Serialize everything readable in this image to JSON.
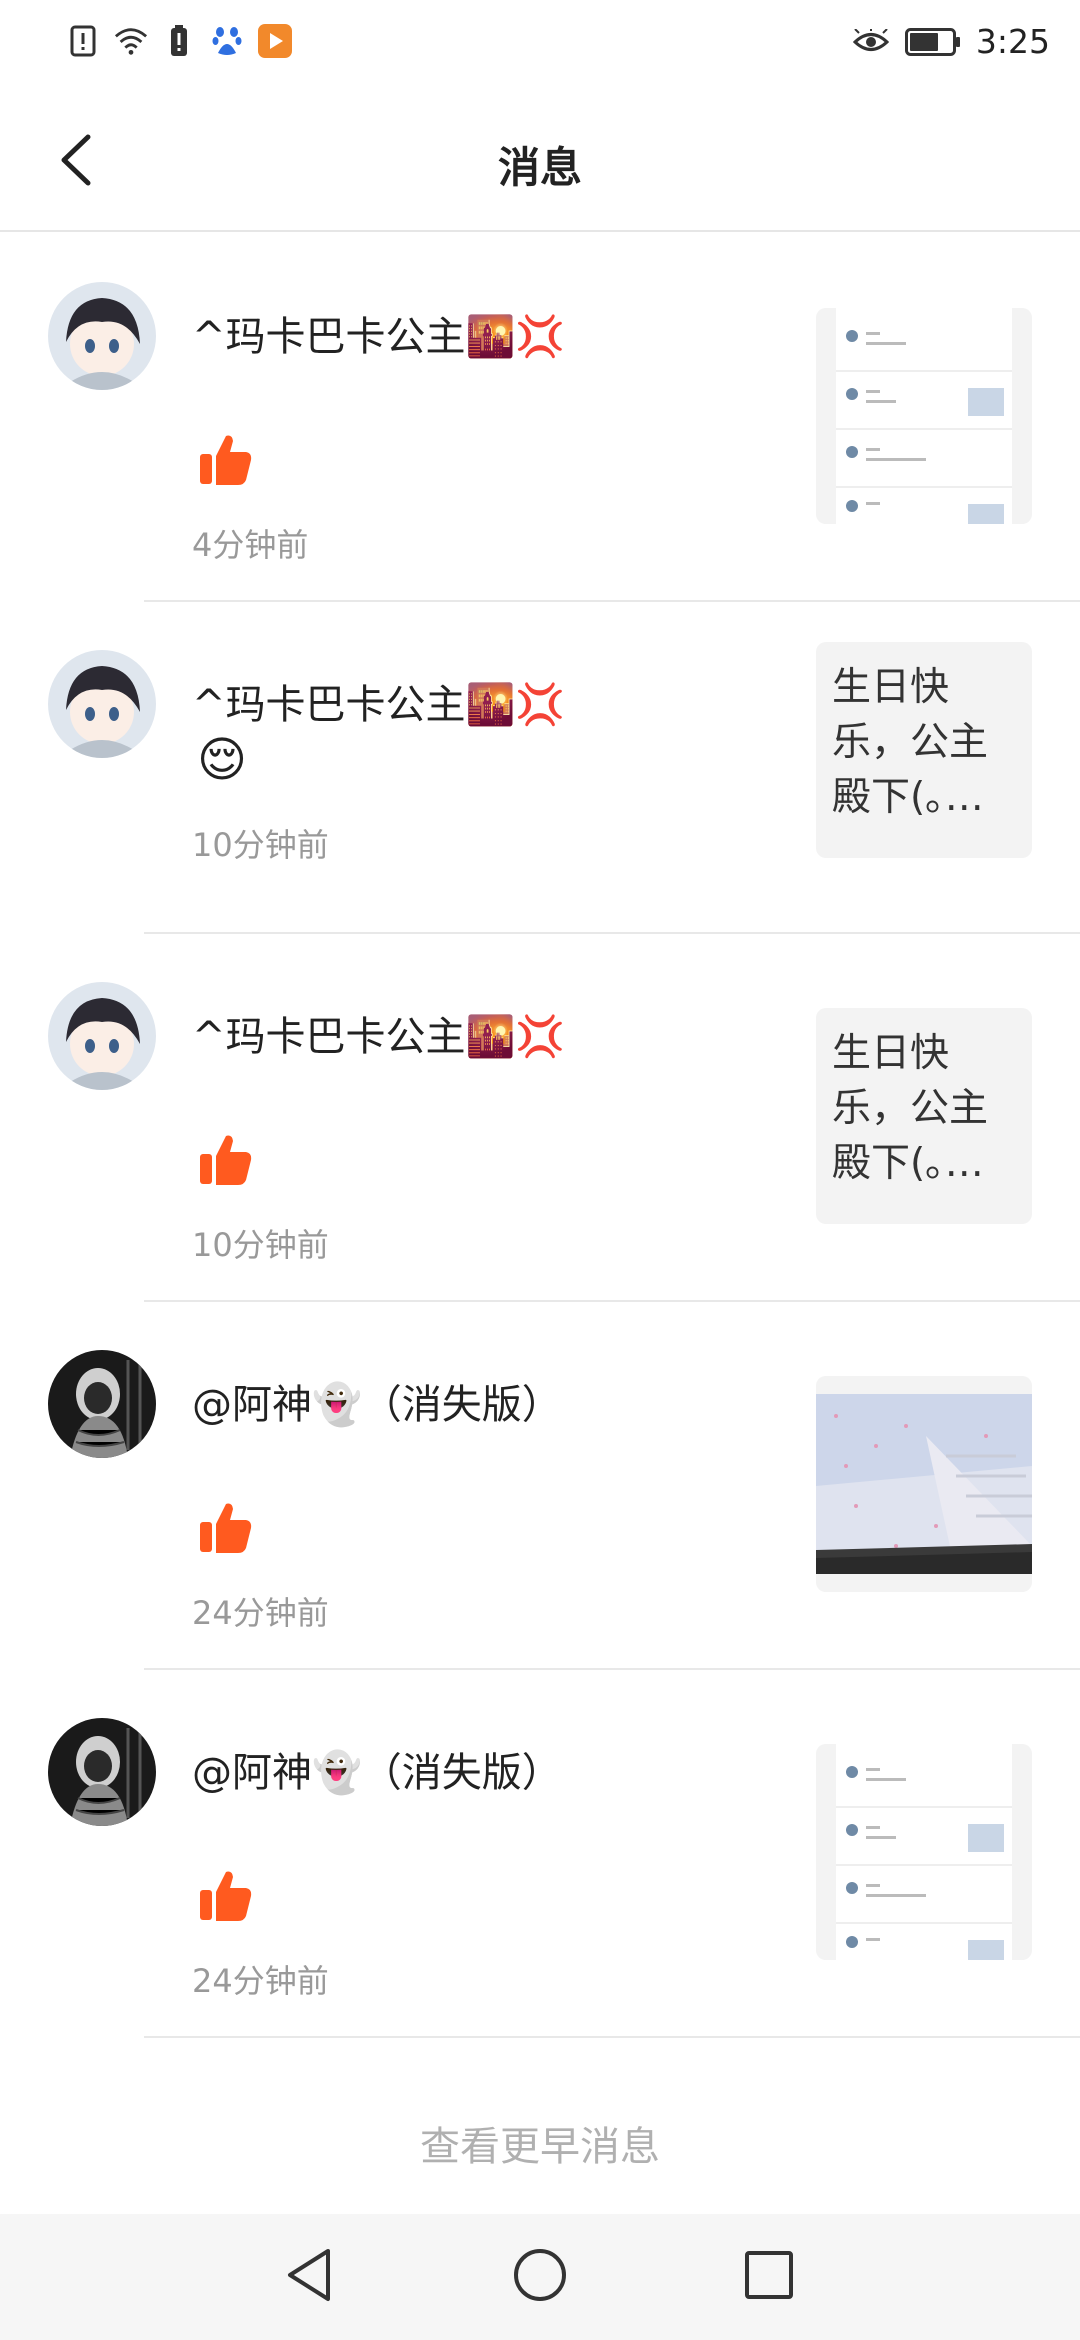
{
  "status_bar": {
    "time": "3:25",
    "left_icons": [
      "alert-icon",
      "wifi-icon",
      "battery-saver-icon",
      "baidu-paw-icon",
      "play-app-icon"
    ],
    "right_icons": [
      "eye-icon",
      "battery-icon"
    ]
  },
  "header": {
    "title": "消息",
    "back_icon": "chevron-left-icon"
  },
  "messages": [
    {
      "user": "^玛卡巴卡公主🌇💢",
      "action_type": "like",
      "content": "",
      "time": "4分钟前",
      "thumb_type": "screenshot",
      "thumb_text": ""
    },
    {
      "user": "^玛卡巴卡公主🌇💢",
      "action_type": "emoji",
      "content": "😌",
      "time": "10分钟前",
      "thumb_type": "text",
      "thumb_text": "生日快乐，公主殿下(｡…"
    },
    {
      "user": "^玛卡巴卡公主🌇💢",
      "action_type": "like",
      "content": "",
      "time": "10分钟前",
      "thumb_type": "text",
      "thumb_text": "生日快乐，公主殿下(｡…"
    },
    {
      "user": "@阿神👻（消失版）",
      "action_type": "like",
      "content": "",
      "time": "24分钟前",
      "thumb_type": "photo",
      "thumb_text": ""
    },
    {
      "user": "@阿神👻（消失版）",
      "action_type": "like",
      "content": "",
      "time": "24分钟前",
      "thumb_type": "screenshot",
      "thumb_text": ""
    }
  ],
  "load_more": "查看更早消息",
  "nav_bar": {
    "icons": [
      "back-triangle-icon",
      "home-circle-icon",
      "recents-square-icon"
    ]
  },
  "colors": {
    "like_orange": "#ff5a1f",
    "time_gray": "#999999",
    "load_more_gray": "#b0b0b0",
    "divider": "#e8e8e8"
  }
}
